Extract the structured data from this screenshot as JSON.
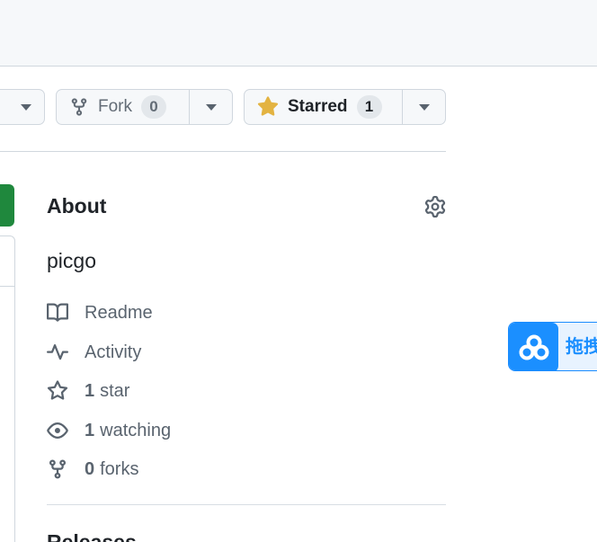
{
  "header": {
    "fork": {
      "label": "Fork",
      "count": "0"
    },
    "star": {
      "label": "Starred",
      "count": "1"
    }
  },
  "about": {
    "title": "About",
    "description": "picgo",
    "items": [
      {
        "icon": "book-icon",
        "count": "",
        "label": "Readme"
      },
      {
        "icon": "pulse-icon",
        "count": "",
        "label": "Activity"
      },
      {
        "icon": "star-outline-icon",
        "count": "1",
        "label": "star"
      },
      {
        "icon": "eye-icon",
        "count": "1",
        "label": "watching"
      },
      {
        "icon": "repo-forked-icon",
        "count": "0",
        "label": "forks"
      }
    ],
    "releases_title": "Releases"
  },
  "floating_widget": {
    "text": "拖拽"
  },
  "colors": {
    "accent_green": "#1f883d",
    "star_yellow": "#e3b341",
    "widget_blue": "#1b8fff"
  }
}
